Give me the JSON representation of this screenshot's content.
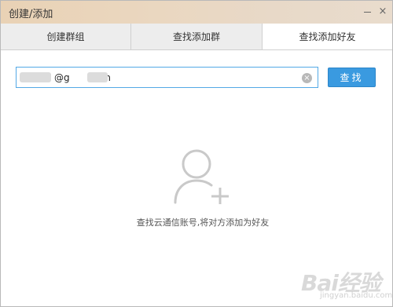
{
  "window": {
    "title": "创建/添加"
  },
  "window_controls": {
    "minimize_icon": "minimize-icon",
    "close_label": "×"
  },
  "tabs": [
    {
      "label": "创建群组",
      "active": false
    },
    {
      "label": "查找添加群",
      "active": false
    },
    {
      "label": "查找添加好友",
      "active": true
    }
  ],
  "search": {
    "value": "@g      .com",
    "clear_icon": "clear-icon",
    "button_label": "查找"
  },
  "empty_state": {
    "icon": "add-user-icon",
    "message": "查找云通信账号,将对方添加为好友"
  },
  "watermark": {
    "main": "Bai经验",
    "sub": "jingyan.baidu.com"
  },
  "colors": {
    "accent": "#3a9ae0",
    "input_border": "#53a9e6",
    "titlebar": "#e9d6bf",
    "tab_inactive": "#ededed"
  }
}
